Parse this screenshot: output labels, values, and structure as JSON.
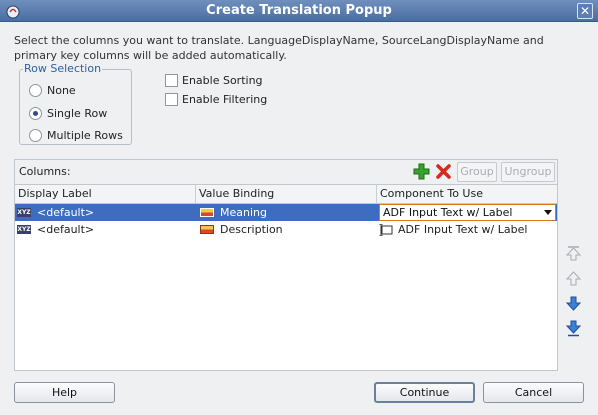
{
  "window": {
    "title": "Create Translation Popup"
  },
  "description": "Select the columns you want to translate.  LanguageDisplayName, SourceLangDisplayName and primary key columns will be added automatically.",
  "row_selection": {
    "legend": "Row Selection",
    "options": [
      {
        "label": "None",
        "checked": false
      },
      {
        "label": "Single Row",
        "checked": true
      },
      {
        "label": "Multiple Rows",
        "checked": false
      }
    ]
  },
  "options": {
    "sorting": {
      "label": "Enable Sorting",
      "checked": false
    },
    "filtering": {
      "label": "Enable Filtering",
      "checked": false
    }
  },
  "columns_panel": {
    "label": "Columns:",
    "group_label": "Group",
    "ungroup_label": "Ungroup",
    "headers": [
      "Display Label",
      "Value Binding",
      "Component To Use"
    ],
    "rows": [
      {
        "display_label": "<default>",
        "value_binding": "Meaning",
        "component": "ADF Input Text w/ Label",
        "selected": true
      },
      {
        "display_label": "<default>",
        "value_binding": "Description",
        "component": "ADF Input Text w/ Label",
        "selected": false
      }
    ]
  },
  "buttons": {
    "help": "Help",
    "continue": "Continue",
    "cancel": "Cancel"
  },
  "colors": {
    "title_bar": "#4a6ea3",
    "selection": "#3e6cc0",
    "legend_text": "#2d5fa8",
    "active_combo_border": "#d77b1a"
  }
}
